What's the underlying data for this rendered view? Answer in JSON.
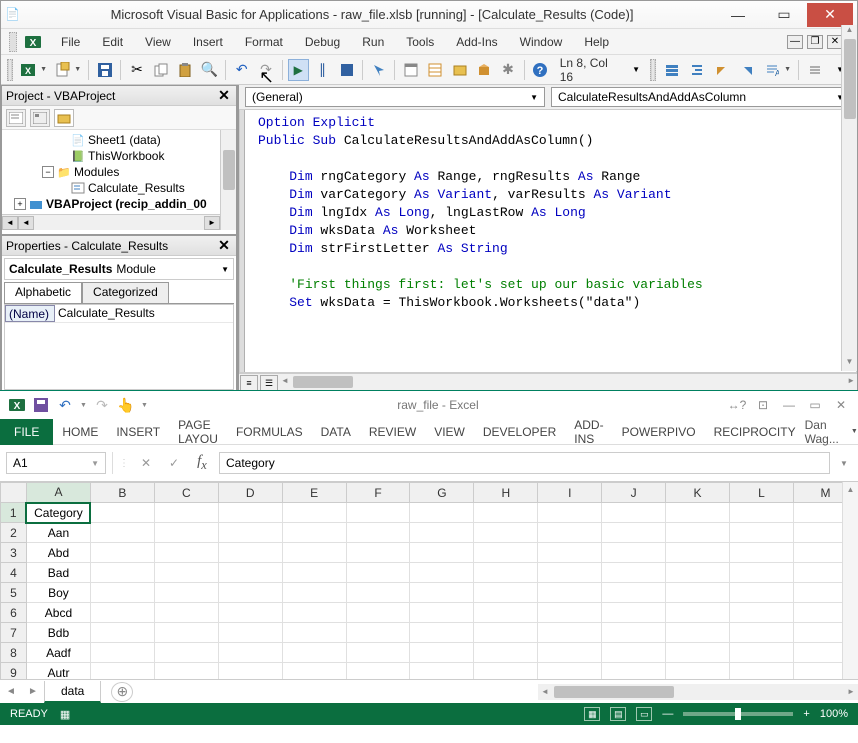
{
  "vba": {
    "title": "Microsoft Visual Basic for Applications - raw_file.xlsb [running] - [Calculate_Results (Code)]",
    "menu": [
      "File",
      "Edit",
      "View",
      "Insert",
      "Format",
      "Debug",
      "Run",
      "Tools",
      "Add-Ins",
      "Window",
      "Help"
    ],
    "cursor_pos": "Ln 8, Col 16",
    "project_title": "Project - VBAProject",
    "tree": {
      "sheet1": "Sheet1 (data)",
      "thiswb": "ThisWorkbook",
      "modules": "Modules",
      "calcres": "Calculate_Results",
      "vbaproj": "VBAProject (recip_addin_00"
    },
    "properties_title": "Properties - Calculate_Results",
    "prop_dd_name": "Calculate_Results",
    "prop_dd_type": "Module",
    "prop_tabs": [
      "Alphabetic",
      "Categorized"
    ],
    "prop_name_label": "(Name)",
    "prop_name_value": "Calculate_Results",
    "code_dd_left": "(General)",
    "code_dd_right": "CalculateResultsAndAddAsColumn",
    "code": {
      "l1a": "Option Explicit",
      "l2a": "Public Sub",
      "l2b": " CalculateResultsAndAddAsColumn()",
      "l4a": "Dim",
      "l4b": " rngCategory ",
      "l4c": "As",
      "l4d": " Range, rngResults ",
      "l4e": "As",
      "l4f": " Range",
      "l5a": "Dim",
      "l5b": " varCategory ",
      "l5c": "As Variant",
      "l5d": ", varResults ",
      "l5e": "As Variant",
      "l6a": "Dim",
      "l6b": " lngIdx ",
      "l6c": "As Long",
      "l6d": ", lngLastRow ",
      "l6e": "As Long",
      "l7a": "Dim",
      "l7b": " wksData ",
      "l7c": "As",
      "l7d": " Worksheet",
      "l8a": "Dim",
      "l8b": " strFirstLetter ",
      "l8c": "As String",
      "l10": "'First things first: let's set up our basic variables",
      "l11a": "Set",
      "l11b": " wksData = ThisWorkbook.Worksheets(\"data\")"
    }
  },
  "excel": {
    "title": "raw_file - Excel",
    "ribbon": [
      "HOME",
      "INSERT",
      "PAGE LAYOU",
      "FORMULAS",
      "DATA",
      "REVIEW",
      "VIEW",
      "DEVELOPER",
      "ADD-INS",
      "POWERPIVO",
      "RECIPROCITY"
    ],
    "file_tab": "FILE",
    "user": "Dan Wag...",
    "name_box": "A1",
    "formula_value": "Category",
    "columns": [
      "A",
      "B",
      "C",
      "D",
      "E",
      "F",
      "G",
      "H",
      "I",
      "J",
      "K",
      "L",
      "M"
    ],
    "rows": [
      {
        "n": "1",
        "a": "Category"
      },
      {
        "n": "2",
        "a": "Aan"
      },
      {
        "n": "3",
        "a": "Abd"
      },
      {
        "n": "4",
        "a": "Bad"
      },
      {
        "n": "5",
        "a": "Boy"
      },
      {
        "n": "6",
        "a": "Abcd"
      },
      {
        "n": "7",
        "a": "Bdb"
      },
      {
        "n": "8",
        "a": "Aadf"
      },
      {
        "n": "9",
        "a": "Autr"
      }
    ],
    "sheet_tab": "data",
    "status": "READY",
    "zoom": "100%"
  }
}
